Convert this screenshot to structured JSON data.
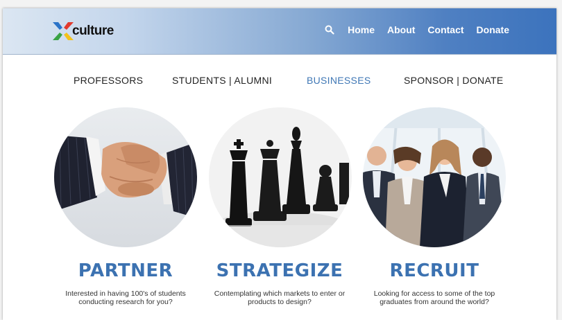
{
  "header": {
    "logo_text": "culture",
    "nav": [
      {
        "label": "Home"
      },
      {
        "label": "About"
      },
      {
        "label": "Contact"
      },
      {
        "label": "Donate"
      }
    ]
  },
  "subnav": [
    {
      "label": "PROFESSORS"
    },
    {
      "label": "STUDENTS | ALUMNI"
    },
    {
      "label": "BUSINESSES"
    },
    {
      "label": "SPONSOR | DONATE"
    }
  ],
  "features": [
    {
      "title": "PARTNER",
      "line1": "Interested in having 100's of students",
      "line2": "conducting research for you?",
      "image": "handshake-photo"
    },
    {
      "title": "STRATEGIZE",
      "line1": "Contemplating which markets to enter or",
      "line2": "products to design?",
      "image": "chess-pieces-photo"
    },
    {
      "title": "RECRUIT",
      "line1": "Looking for access to some of the top",
      "line2": "graduates from around the world?",
      "image": "business-team-photo"
    }
  ],
  "colors": {
    "accent": "#3c72b1",
    "header_gradient_end": "#3c73bd",
    "active_subnav": "#3f77b5"
  }
}
